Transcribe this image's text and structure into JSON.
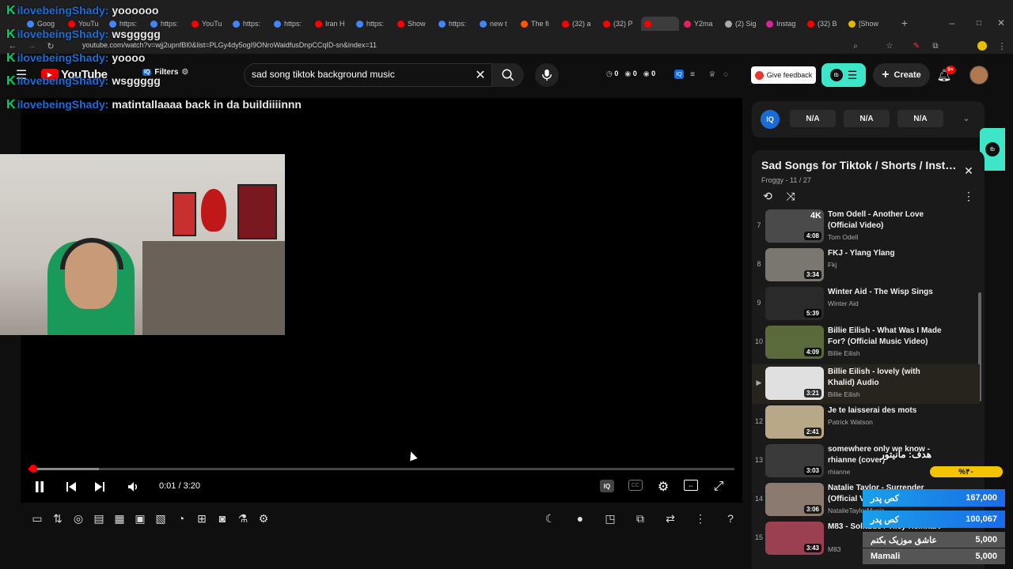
{
  "browser": {
    "tabs": [
      {
        "label": "Goog",
        "color": "#4285f4"
      },
      {
        "label": "YouTu",
        "color": "#ff0000"
      },
      {
        "label": "https:",
        "color": "#4285f4"
      },
      {
        "label": "https:",
        "color": "#4285f4"
      },
      {
        "label": "YouTu",
        "color": "#ff0000"
      },
      {
        "label": "https:",
        "color": "#4285f4"
      },
      {
        "label": "https:",
        "color": "#4285f4"
      },
      {
        "label": "Iran H",
        "color": "#ff0000"
      },
      {
        "label": "https:",
        "color": "#4285f4"
      },
      {
        "label": "Show",
        "color": "#ff0000"
      },
      {
        "label": "https:",
        "color": "#4285f4"
      },
      {
        "label": "new t",
        "color": "#4285f4"
      },
      {
        "label": "The fi",
        "color": "#ff5500"
      },
      {
        "label": "(32) a",
        "color": "#ff0000"
      },
      {
        "label": "(32) P",
        "color": "#ff0000"
      },
      {
        "label": "",
        "color": "#ff0000"
      },
      {
        "label": "Y2ma",
        "color": "#e0245e"
      },
      {
        "label": "(2) Sig",
        "color": "#aaaaaa"
      },
      {
        "label": "Instag",
        "color": "#d6249f"
      },
      {
        "label": "(32) B",
        "color": "#ff0000"
      },
      {
        "label": "[Show",
        "color": "#e6b800"
      }
    ],
    "url": "youtube.com/watch?v=wjj2upnfBl0&list=PLGy4dy5ogI9ONroWaidfusDnpCCqID-sn&index=11"
  },
  "header": {
    "logo": "YouTube",
    "filters_label": "Filters",
    "search_value": "sad song tiktok background music",
    "stats": [
      "0",
      "0",
      "0"
    ],
    "give_feedback": "Give feedback",
    "create_label": "Create",
    "notif_badge": "9+"
  },
  "chat": [
    {
      "user": "ilovebeingShady:",
      "msg": "yoooooo"
    },
    {
      "user": "ilovebeingShady:",
      "msg": "wsggggg"
    },
    {
      "user": "ilovebeingShady:",
      "msg": "yoooo"
    },
    {
      "user": "ilovebeingShady:",
      "msg": "wsggggg"
    },
    {
      "user": "ilovebeingShady:",
      "msg": "matintallaaaa back in da buildiiiinnn"
    }
  ],
  "player": {
    "time": "0:01 / 3:20",
    "progress_fraction": 0.005,
    "buffer_fraction": 0.1
  },
  "iq": {
    "badge": "IQ",
    "pills": [
      "N/A",
      "N/A",
      "N/A"
    ]
  },
  "playlist": {
    "title": "Sad Songs for Tiktok / Shorts / Insta...",
    "subtitle": "Froggy - 11 / 27",
    "items": [
      {
        "idx": "7",
        "title": "Tom Odell - Another Love (Official Video)",
        "channel": "Tom Odell",
        "dur": "4:08",
        "color": "#4a4a4a",
        "badge": "4K"
      },
      {
        "idx": "8",
        "title": "FKJ - Ylang Ylang",
        "channel": "Fkj",
        "dur": "3:34",
        "color": "#7a7670"
      },
      {
        "idx": "9",
        "title": "Winter Aid - The Wisp Sings",
        "channel": "Winter Aid",
        "dur": "5:39",
        "color": "#2a2a2a"
      },
      {
        "idx": "10",
        "title": "Billie Eilish - What Was I Made For? (Official Music Video)",
        "channel": "Billie Eilish",
        "dur": "4:09",
        "color": "#5a6a3a"
      },
      {
        "idx": "▶",
        "title": "Billie Eilish - lovely (with Khalid) Audio",
        "channel": "Billie Eilish",
        "dur": "3:21",
        "color": "#e0e0e0"
      },
      {
        "idx": "12",
        "title": "Je te laisserai des mots",
        "channel": "Patrick Watson",
        "dur": "2:41",
        "color": "#b8a888"
      },
      {
        "idx": "13",
        "title": "somewhere only we know - rhianne (cover)",
        "channel": "rhianne",
        "dur": "3:03",
        "color": "#3a3a3a"
      },
      {
        "idx": "14",
        "title": "Natalie Taylor - Surrender (Official Video)",
        "channel": "NatalieTaylorMusic",
        "dur": "3:06",
        "color": "#8a7a70"
      },
      {
        "idx": "15",
        "title": "M83 - Solitude / Tiley Reinhart",
        "channel": "M83",
        "dur": "3:43",
        "color": "#9a4050"
      }
    ]
  },
  "overlay": {
    "goal_label": "هدف: مانیتور",
    "goal_percent": "%۴۰",
    "donations": [
      {
        "name": "کص پدر",
        "amount": "167,000"
      },
      {
        "name": "کص پدر",
        "amount": "100,067"
      },
      {
        "name": "عاشق موزیک بکتم",
        "amount": "5,000"
      },
      {
        "name": "Mamali",
        "amount": "5,000"
      }
    ]
  }
}
